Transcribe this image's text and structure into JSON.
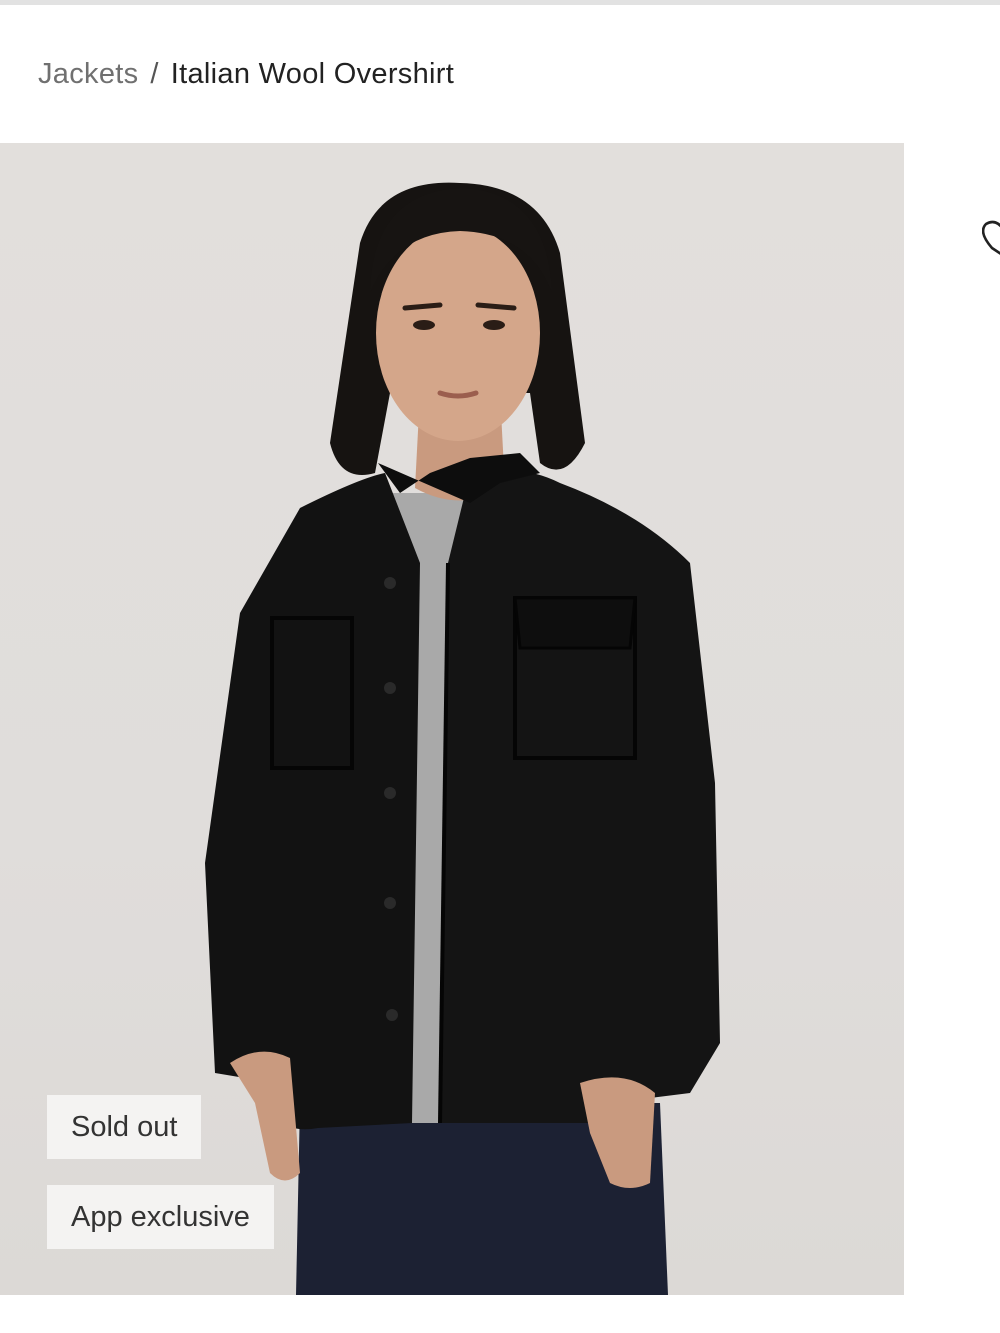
{
  "breadcrumb": {
    "parent": "Jackets",
    "separator": "/",
    "current": "Italian Wool Overshirt"
  },
  "badges": {
    "sold_out": "Sold out",
    "app_exclusive": "App exclusive"
  },
  "icons": {
    "wishlist": "heart-icon"
  },
  "colors": {
    "image_background": "#e0dddb",
    "jacket": "#111111",
    "tee": "#a9a9a9",
    "jeans": "#1c2133",
    "badge_background": "#f5f4f2"
  }
}
